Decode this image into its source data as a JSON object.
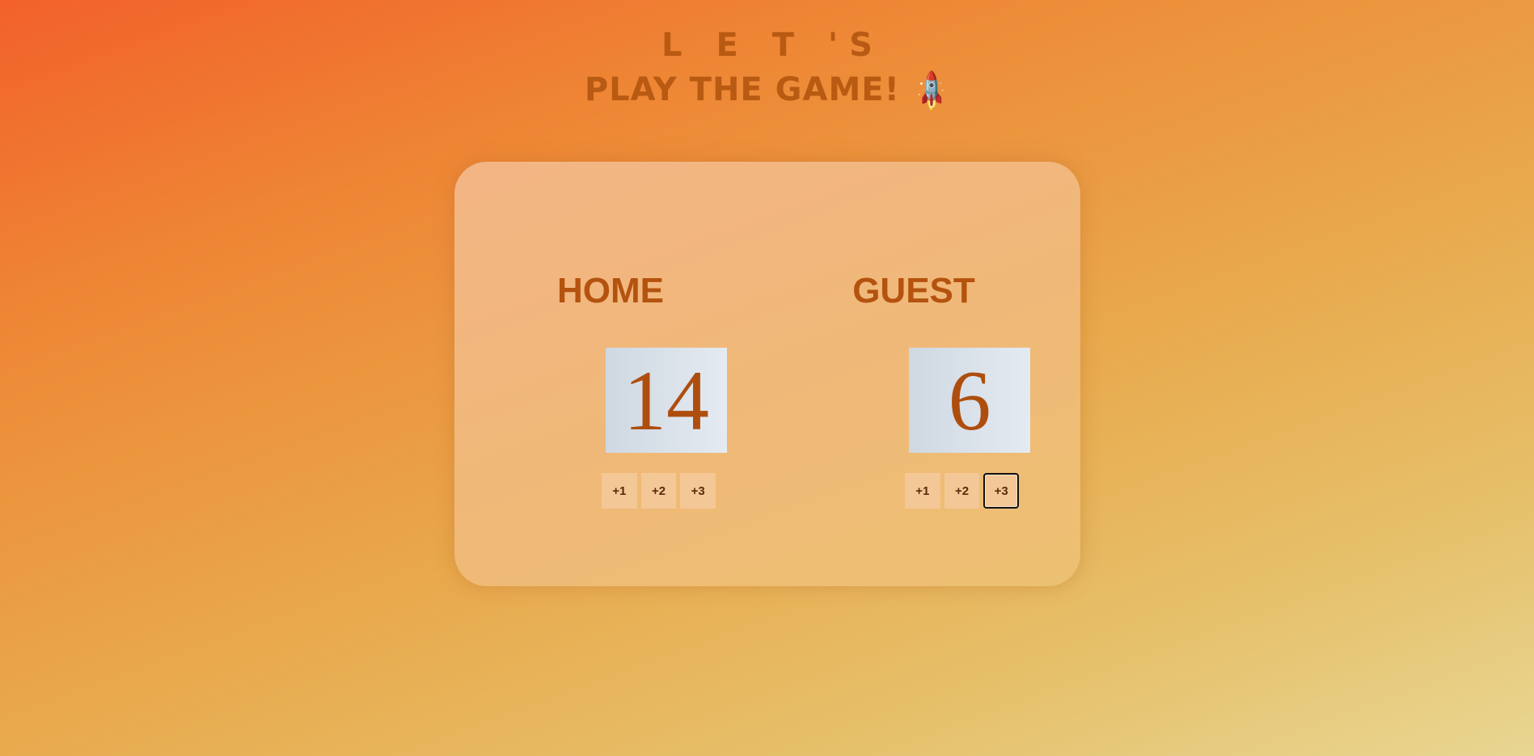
{
  "heading": {
    "line1": "L E T 'S",
    "line2": "PLAY THE GAME!",
    "rocket_icon": "🚀"
  },
  "scoreboard": {
    "home": {
      "name": "HOME",
      "score": "14",
      "buttons": [
        "+1",
        "+2",
        "+3"
      ]
    },
    "guest": {
      "name": "GUEST",
      "score": "6",
      "buttons": [
        "+1",
        "+2",
        "+3"
      ]
    }
  },
  "colors": {
    "accent": "#b4530e",
    "score_bg": "#dfe6ee"
  }
}
